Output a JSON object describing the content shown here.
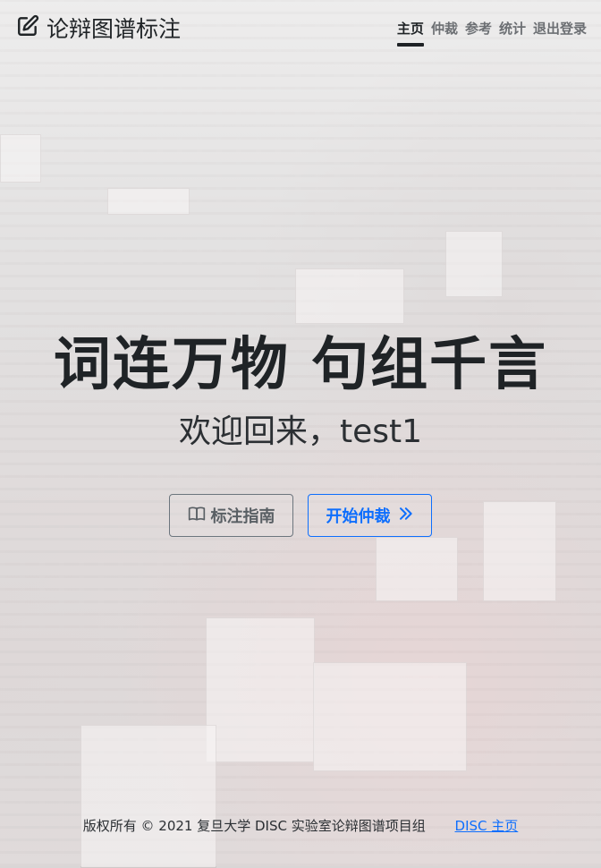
{
  "brand": {
    "title": "论辩图谱标注",
    "icon": "edit-icon"
  },
  "nav": {
    "items": [
      {
        "label": "主页",
        "active": true
      },
      {
        "label": "仲裁",
        "active": false
      },
      {
        "label": "参考",
        "active": false
      },
      {
        "label": "统计",
        "active": false
      },
      {
        "label": "退出登录",
        "active": false
      }
    ]
  },
  "hero": {
    "slogan": "词连万物 句组千言",
    "welcome": "欢迎回来，test1"
  },
  "buttons": {
    "guide_label": "标注指南",
    "guide_icon": "book-icon",
    "start_label": "开始仲裁",
    "start_icon": "chevrons-right-icon"
  },
  "footer": {
    "copyright": "版权所有 © 2021 复旦大学 DISC 实验室论辩图谱项目组",
    "link_label": "DISC 主页"
  },
  "colors": {
    "accent": "#0d6efd",
    "text": "#1f2326",
    "muted": "#6c757d"
  }
}
